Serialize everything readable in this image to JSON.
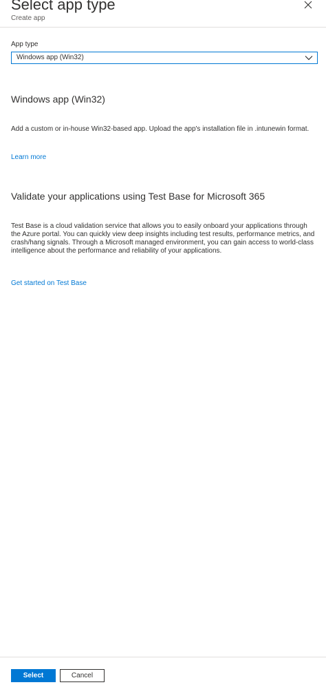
{
  "header": {
    "title": "Select app type",
    "subtitle": "Create app",
    "close_icon": "close-icon"
  },
  "form": {
    "app_type_label": "App type",
    "app_type_value": "Windows app (Win32)",
    "dropdown_icon": "chevron-down-icon"
  },
  "win32_section": {
    "title": "Windows app (Win32)",
    "description": "Add a custom or in-house Win32-based app. Upload the app's installation file in .intunewin format.",
    "learn_more": "Learn more"
  },
  "testbase_section": {
    "title": "Validate your applications using Test Base for Microsoft 365",
    "description": "Test Base is a cloud validation service that allows you to easily onboard your applications through the Azure portal. You can quickly view deep insights including test results, performance metrics, and crash/hang signals. Through a Microsoft managed environment, you can gain access to world-class intelligence about the performance and reliability of your applications.",
    "link": "Get started on Test Base"
  },
  "footer": {
    "select_label": "Select",
    "cancel_label": "Cancel"
  },
  "colors": {
    "accent": "#0078d4",
    "text": "#323130",
    "secondary_text": "#605e5c",
    "divider": "#e1dfdd"
  }
}
